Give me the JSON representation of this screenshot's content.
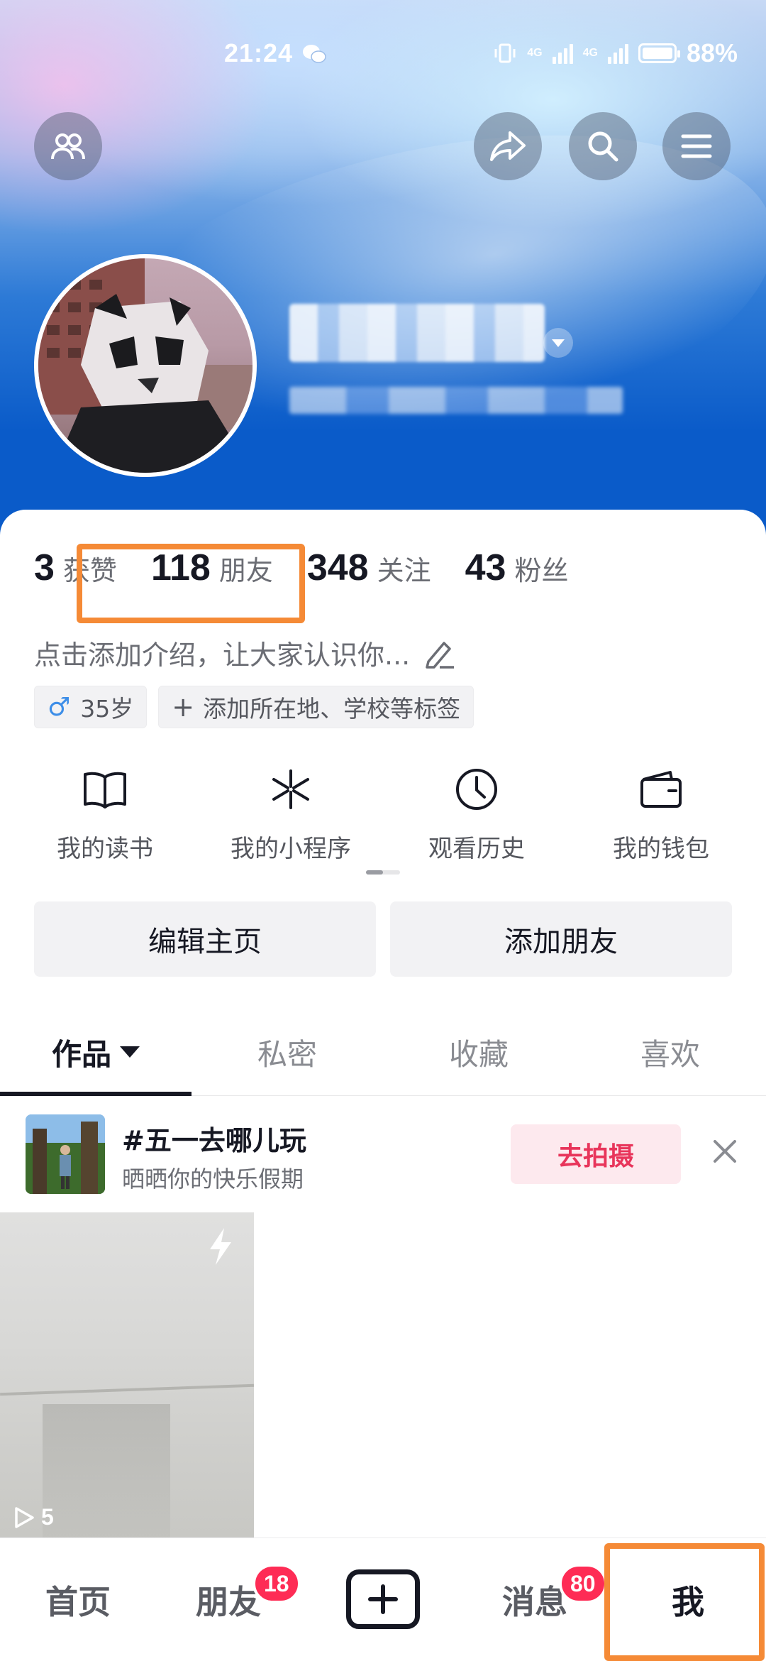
{
  "status_bar": {
    "time": "21:24",
    "network_1": "4G",
    "network_2": "4G",
    "battery": "88%",
    "battery_level": 0.88
  },
  "header": {
    "friends_icon": "friends-icon",
    "share_icon": "share-icon",
    "search_icon": "search-icon",
    "menu_icon": "menu-icon"
  },
  "profile": {
    "avatar": "panda-avatar",
    "name_blurred": true
  },
  "stats": [
    {
      "num": "3",
      "label": "获赞"
    },
    {
      "num": "118",
      "label": "朋友"
    },
    {
      "num": "348",
      "label": "关注"
    },
    {
      "num": "43",
      "label": "粉丝"
    }
  ],
  "bio": {
    "placeholder": "点击添加介绍，让大家认识你..."
  },
  "tags": {
    "age": "35岁",
    "add": "添加所在地、学校等标签"
  },
  "quick_links": [
    {
      "label": "我的读书",
      "icon": "book-icon"
    },
    {
      "label": "我的小程序",
      "icon": "mini-program-icon"
    },
    {
      "label": "观看历史",
      "icon": "clock-icon"
    },
    {
      "label": "我的钱包",
      "icon": "wallet-icon"
    }
  ],
  "actions": {
    "edit": "编辑主页",
    "add_friend": "添加朋友"
  },
  "tabs": [
    "作品",
    "私密",
    "收藏",
    "喜欢"
  ],
  "topic": {
    "title": "#五一去哪儿玩",
    "subtitle": "晒晒你的快乐假期",
    "button": "去拍摄"
  },
  "video": {
    "plays": "5"
  },
  "bottom_nav": {
    "home": "首页",
    "friends": "朋友",
    "friends_badge": "18",
    "messages": "消息",
    "messages_badge": "80",
    "me": "我"
  },
  "colors": {
    "highlight": "#f58a36",
    "accent": "#fe2c55"
  }
}
